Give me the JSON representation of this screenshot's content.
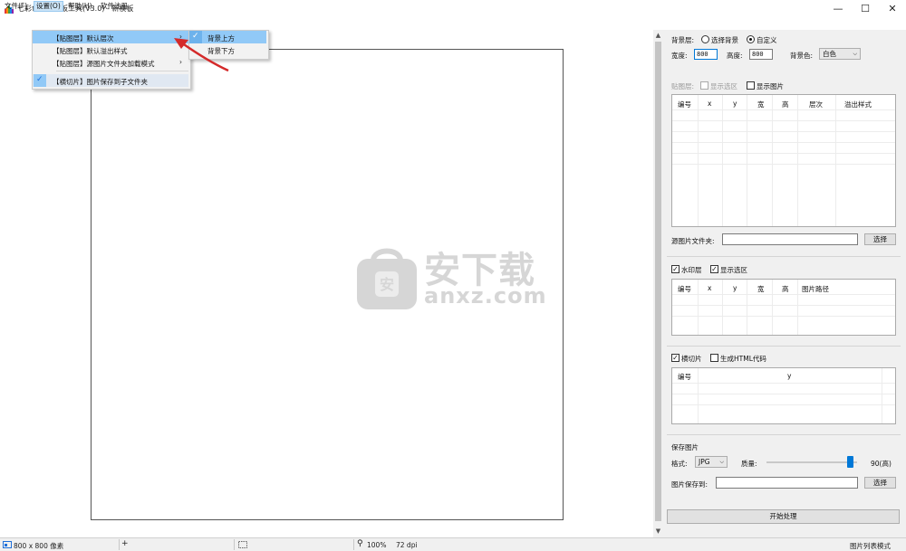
{
  "window": {
    "title": "七彩色图片排板工具(V3.0) - 新模板",
    "controls": {
      "minimize": "—",
      "maximize": "☐",
      "close": "✕"
    }
  },
  "menubar": {
    "items": [
      {
        "label": "文件(F)"
      },
      {
        "label": "设置(O)"
      },
      {
        "label": "帮助(H)"
      },
      {
        "label": "软件注册"
      }
    ]
  },
  "settings_menu": {
    "items": [
      {
        "label": "【贴图层】默认层次",
        "has_submenu": true,
        "highlighted": true,
        "checked": false
      },
      {
        "label": "【贴图层】默认溢出样式",
        "has_submenu": false,
        "highlighted": false,
        "checked": false
      },
      {
        "label": "【贴图层】源图片文件夹加载模式",
        "has_submenu": true,
        "highlighted": false,
        "checked": false
      },
      {
        "label": "【横切片】图片保存到子文件夹",
        "has_submenu": false,
        "highlighted": false,
        "checked": true
      }
    ],
    "submenu_arrow": "›",
    "check_glyph": "✓"
  },
  "layer_submenu": {
    "items": [
      {
        "label": "背景上方",
        "checked": true
      },
      {
        "label": "背景下方",
        "checked": false
      }
    ]
  },
  "watermark": {
    "cn": "安下载",
    "en": "anxz.com",
    "badge": "安"
  },
  "background_panel": {
    "label": "背景层:",
    "option_select_bg": "选择背景",
    "option_custom": "自定义",
    "selected_option": "custom",
    "width_label": "宽度:",
    "width_value": "800",
    "height_label": "高度:",
    "height_value": "800",
    "bgcolor_label": "背景色:",
    "bgcolor_value": "白色"
  },
  "paste_panel": {
    "label": "贴图层:",
    "show_selection_label": "显示选区",
    "show_selection_checked": false,
    "show_image_label": "显示图片",
    "show_image_checked": false,
    "columns": [
      "编号",
      "x",
      "y",
      "宽",
      "高",
      "层次",
      "溢出样式"
    ],
    "source_folder_label": "源图片文件夹:",
    "source_folder_value": "",
    "choose_button": "选择"
  },
  "watermark_panel": {
    "watermark_label": "水印层",
    "watermark_checked": true,
    "show_selection_label": "显示选区",
    "show_selection_checked": true,
    "columns": [
      "编号",
      "x",
      "y",
      "宽",
      "高",
      "图片路径"
    ]
  },
  "slice_panel": {
    "slice_label": "横切片",
    "slice_checked": true,
    "html_label": "生成HTML代码",
    "html_checked": false,
    "columns": [
      "编号",
      "y"
    ]
  },
  "save_panel": {
    "title": "保存图片",
    "format_label": "格式:",
    "format_value": "JPG",
    "quality_label": "质量:",
    "quality_value": 90,
    "quality_text": "90(高)",
    "save_to_label": "图片保存到:",
    "save_to_value": "",
    "choose_button": "选择",
    "start_button": "开始处理"
  },
  "statusbar": {
    "size": "800 x 800 像素",
    "zoom": "100%",
    "dpi": "72 dpi",
    "mode": "图片列表模式"
  },
  "colors": {
    "menu_highlight": "#91c9f7",
    "panel_bg": "#f0f0f0",
    "accent": "#0078d7",
    "annotation_arrow": "#d42a2a"
  }
}
